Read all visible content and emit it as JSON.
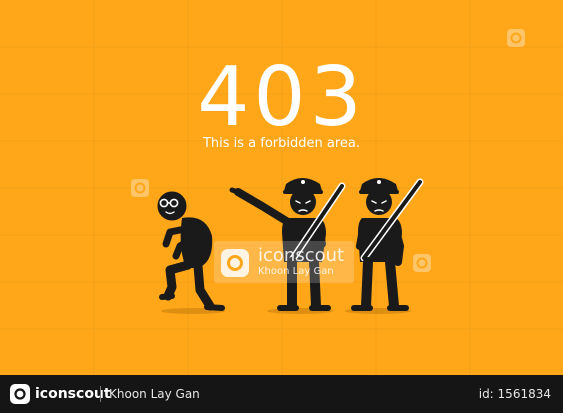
{
  "error": {
    "code": "403",
    "message": "This is a forbidden area."
  },
  "illustration": {
    "figures": [
      "sneaking-intruder-with-glasses",
      "pointing-police-officer",
      "police-officer-with-baton"
    ]
  },
  "watermark": {
    "brand": "iconscout",
    "author": "Khoon Lay Gan"
  },
  "footer": {
    "brand": "iconscout",
    "author": "Khoon Lay Gan",
    "asset_id": "id: 1561834"
  },
  "colors": {
    "background": "#ffa619",
    "figure": "#1a1a1a",
    "text": "#ffffff",
    "footer": "#151515"
  }
}
